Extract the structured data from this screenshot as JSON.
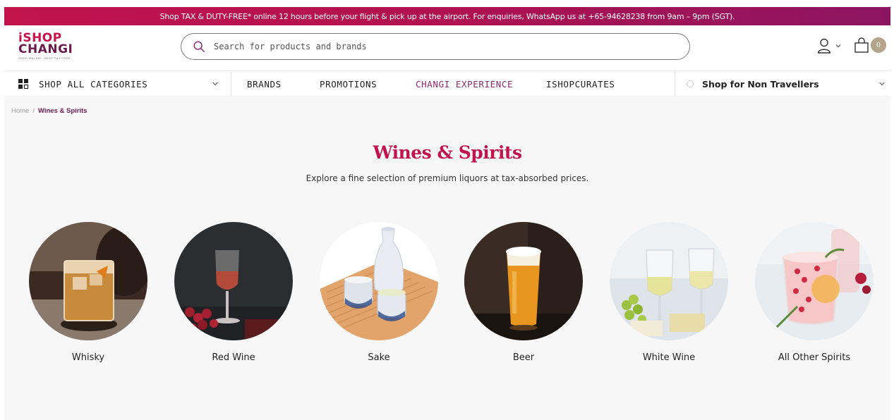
{
  "promo": {
    "text": "Shop TAX & DUTY-FREE* online 12 hours before your flight & pick up at the airport. For enquiries, WhatsApp us at +65-94628238 from 9am – 9pm (SGT)."
  },
  "header": {
    "logo_top": "iSHOP",
    "logo_bottom": "CHANGI",
    "logo_tagline": "SHOP ONLINE. SHOP TAX FREE.",
    "search_placeholder": "Search for products and brands",
    "cart_count": "0"
  },
  "nav": {
    "categories_label": "SHOP ALL CATEGORIES",
    "links": [
      {
        "label": "BRANDS"
      },
      {
        "label": "PROMOTIONS"
      },
      {
        "label": "CHANGI EXPERIENCE"
      },
      {
        "label": "ISHOPCURATES"
      }
    ],
    "non_travellers_label": "Shop for Non Travellers"
  },
  "breadcrumb": {
    "home": "Home",
    "separator": "/",
    "current": "Wines & Spirits"
  },
  "page": {
    "title": "Wines & Spirits",
    "subtitle": "Explore a fine selection of premium liquors at tax-absorbed prices."
  },
  "categories": [
    {
      "label": "Whisky"
    },
    {
      "label": "Red Wine"
    },
    {
      "label": "Sake"
    },
    {
      "label": "Beer"
    },
    {
      "label": "White Wine"
    },
    {
      "label": "All Other Spirits"
    }
  ],
  "colors": {
    "brand": "#c2134d",
    "brand_dark": "#6a1b4d",
    "accent_nav": "#8a2a6e",
    "cart_badge": "#b5a48c"
  }
}
